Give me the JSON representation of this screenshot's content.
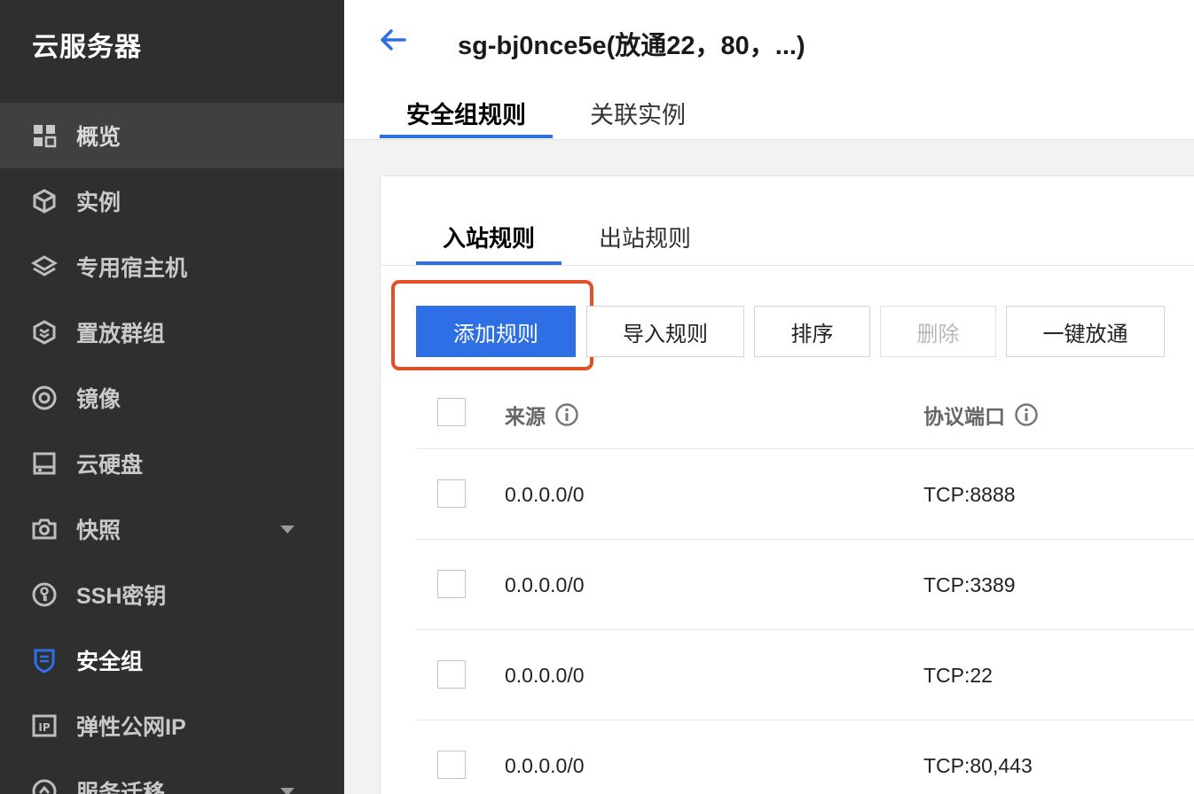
{
  "sidebar": {
    "title": "云服务器",
    "items": [
      {
        "label": "概览",
        "icon": "grid-icon"
      },
      {
        "label": "实例",
        "icon": "cube-icon"
      },
      {
        "label": "专用宿主机",
        "icon": "layers-icon"
      },
      {
        "label": "置放群组",
        "icon": "hexagon-icon"
      },
      {
        "label": "镜像",
        "icon": "disc-icon"
      },
      {
        "label": "云硬盘",
        "icon": "disk-icon"
      },
      {
        "label": "快照",
        "icon": "camera-icon"
      },
      {
        "label": "SSH密钥",
        "icon": "key-icon"
      },
      {
        "label": "安全组",
        "icon": "shield-icon"
      },
      {
        "label": "弹性公网IP",
        "icon": "ip-icon"
      },
      {
        "label": "服务迁移",
        "icon": "migrate-icon"
      }
    ]
  },
  "header": {
    "title": "sg-bj0nce5e(放通22，80，...)",
    "tabs": [
      {
        "label": "安全组规则"
      },
      {
        "label": "关联实例"
      }
    ]
  },
  "rules": {
    "tabs": [
      {
        "label": "入站规则"
      },
      {
        "label": "出站规则"
      }
    ],
    "buttons": {
      "add": "添加规则",
      "import": "导入规则",
      "sort": "排序",
      "delete": "删除",
      "open_all": "一键放通"
    },
    "columns": {
      "source": "来源",
      "port": "协议端口"
    },
    "rows": [
      {
        "source": "0.0.0.0/0",
        "port": "TCP:8888"
      },
      {
        "source": "0.0.0.0/0",
        "port": "TCP:3389"
      },
      {
        "source": "0.0.0.0/0",
        "port": "TCP:22"
      },
      {
        "source": "0.0.0.0/0",
        "port": "TCP:80,443"
      }
    ]
  },
  "colors": {
    "accent": "#2e6fe6",
    "highlight": "#e2502a",
    "sidebar_bg": "#2f2f2f"
  }
}
